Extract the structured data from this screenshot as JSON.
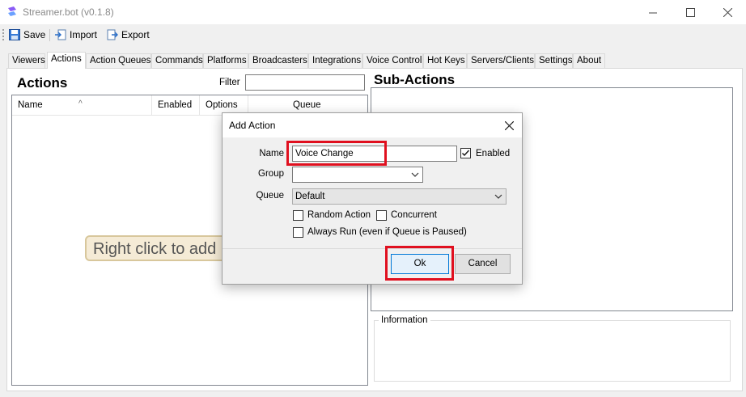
{
  "window": {
    "title": "Streamer.bot (v0.1.8)"
  },
  "toolbar": {
    "save_label": "Save",
    "import_label": "Import",
    "export_label": "Export"
  },
  "tabs": [
    "Viewers",
    "Actions",
    "Action Queues",
    "Commands",
    "Platforms",
    "Broadcasters",
    "Integrations",
    "Voice Control",
    "Hot Keys",
    "Servers/Clients",
    "Settings",
    "About"
  ],
  "active_tab": "Actions",
  "actions_panel": {
    "title": "Actions",
    "filter_label": "Filter",
    "filter_value": "",
    "columns": [
      "Name",
      "Enabled",
      "Options",
      "Queue"
    ],
    "empty_hint": "Right click to add"
  },
  "sub_actions": {
    "title": "Sub-Actions",
    "info_label": "Information"
  },
  "dialog": {
    "title": "Add Action",
    "name_label": "Name",
    "name_value": "Voice Change",
    "enabled_label": "Enabled",
    "enabled_checked": true,
    "group_label": "Group",
    "group_value": "",
    "queue_label": "Queue",
    "queue_value": "Default",
    "random_action_label": "Random Action",
    "concurrent_label": "Concurrent",
    "always_run_label": "Always Run (even if Queue is Paused)",
    "ok_label": "Ok",
    "cancel_label": "Cancel"
  },
  "colors": {
    "highlight": "#e0101f",
    "accent": "#0078d7",
    "hint_bg": "#f5ebd6"
  }
}
